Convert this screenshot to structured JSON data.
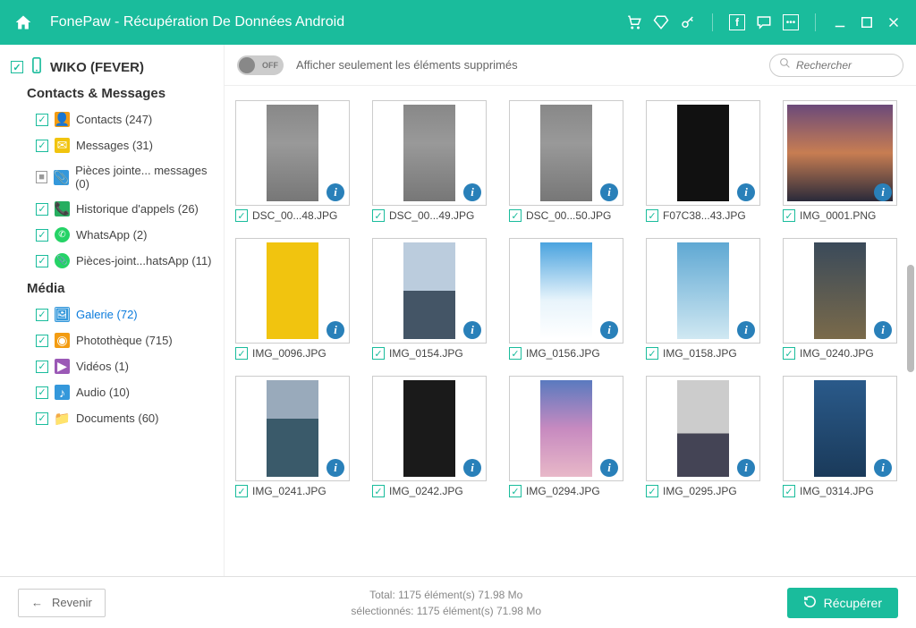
{
  "header": {
    "title": "FonePaw - Récupération De Données Android"
  },
  "device": {
    "name": "WIKO (FEVER)"
  },
  "sections": {
    "contacts": "Contacts & Messages",
    "media": "Média"
  },
  "tree": {
    "contacts": [
      {
        "label": "Contacts (247)",
        "checked": true
      },
      {
        "label": "Messages (31)",
        "checked": true
      },
      {
        "label": "Pièces jointe... messages (0)",
        "checked": false,
        "grey": true
      },
      {
        "label": "Historique d'appels (26)",
        "checked": true
      },
      {
        "label": "WhatsApp (2)",
        "checked": true
      },
      {
        "label": "Pièces-joint...hatsApp (11)",
        "checked": true
      }
    ],
    "media": [
      {
        "label": "Galerie (72)",
        "checked": true,
        "active": true
      },
      {
        "label": "Photothèque (715)",
        "checked": true
      },
      {
        "label": "Vidéos (1)",
        "checked": true
      },
      {
        "label": "Audio (10)",
        "checked": true
      },
      {
        "label": "Documents (60)",
        "checked": true
      }
    ]
  },
  "toolbar": {
    "toggle_state": "OFF",
    "label": "Afficher seulement les éléments supprimés",
    "search_placeholder": "Rechercher"
  },
  "grid": [
    {
      "name": "DSC_00...48.JPG",
      "bg": "bg-grey",
      "wide": false
    },
    {
      "name": "DSC_00...49.JPG",
      "bg": "bg-grey",
      "wide": false
    },
    {
      "name": "DSC_00...50.JPG",
      "bg": "bg-grey",
      "wide": false
    },
    {
      "name": "F07C38...43.JPG",
      "bg": "bg-dark",
      "wide": false
    },
    {
      "name": "IMG_0001.PNG",
      "bg": "bg-sunset",
      "wide": true
    },
    {
      "name": "IMG_0096.JPG",
      "bg": "bg-yellow",
      "wide": false
    },
    {
      "name": "IMG_0154.JPG",
      "bg": "bg-mtn",
      "wide": false
    },
    {
      "name": "IMG_0156.JPG",
      "bg": "bg-sky",
      "wide": false
    },
    {
      "name": "IMG_0158.JPG",
      "bg": "bg-sky2",
      "wide": false
    },
    {
      "name": "IMG_0240.JPG",
      "bg": "bg-rocks",
      "wide": false
    },
    {
      "name": "IMG_0241.JPG",
      "bg": "bg-sea",
      "wide": false
    },
    {
      "name": "IMG_0242.JPG",
      "bg": "bg-cat",
      "wide": false
    },
    {
      "name": "IMG_0294.JPG",
      "bg": "bg-grad",
      "wide": false
    },
    {
      "name": "IMG_0295.JPG",
      "bg": "bg-peaks",
      "wide": false
    },
    {
      "name": "IMG_0314.JPG",
      "bg": "bg-waves",
      "wide": false
    }
  ],
  "footer": {
    "back": "Revenir",
    "total": "Total: 1175 élément(s) 71.98 Mo",
    "selected": "sélectionnés: 1175 élément(s) 71.98 Mo",
    "recover": "Récupérer"
  }
}
